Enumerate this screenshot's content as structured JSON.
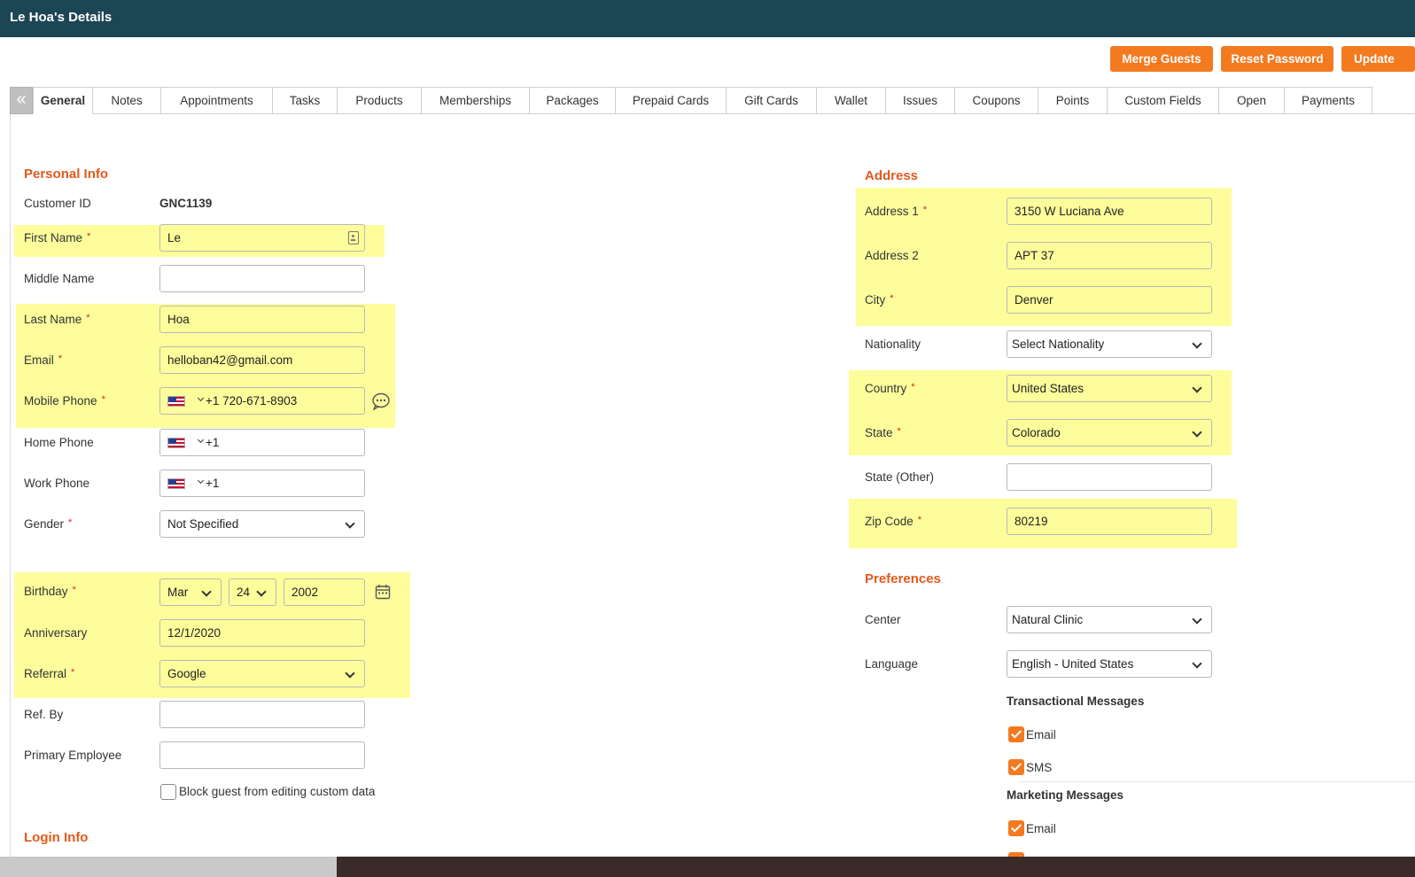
{
  "header": {
    "title": "Le Hoa's Details"
  },
  "actions": {
    "merge": "Merge Guests",
    "reset": "Reset Password",
    "update": "Update"
  },
  "tabs": [
    "General",
    "Notes",
    "Appointments",
    "Tasks",
    "Products",
    "Memberships",
    "Packages",
    "Prepaid Cards",
    "Gift Cards",
    "Wallet",
    "Issues",
    "Coupons",
    "Points",
    "Custom Fields",
    "Open",
    "Payments"
  ],
  "personal": {
    "title": "Personal Info",
    "customer_id_label": "Customer ID",
    "customer_id": "GNC1139",
    "first_name_label": "First Name",
    "first_name": "Le",
    "middle_name_label": "Middle Name",
    "middle_name": "",
    "last_name_label": "Last Name",
    "last_name": "Hoa",
    "email_label": "Email",
    "email": "helloban42@gmail.com",
    "mobile_label": "Mobile Phone",
    "mobile": "+1 720-671-8903",
    "home_label": "Home Phone",
    "home": "+1",
    "work_label": "Work Phone",
    "work": "+1",
    "gender_label": "Gender",
    "gender": "Not Specified",
    "birthday_label": "Birthday",
    "birth_month": "Mar",
    "birth_day": "24",
    "birth_year": "2002",
    "anniversary_label": "Anniversary",
    "anniversary": "12/1/2020",
    "referral_label": "Referral",
    "referral": "Google",
    "refby_label": "Ref. By",
    "refby": "",
    "primary_emp_label": "Primary Employee",
    "primary_emp": "",
    "block_label": "Block guest from editing custom data"
  },
  "login": {
    "title": "Login Info"
  },
  "address": {
    "title": "Address",
    "addr1_label": "Address 1",
    "addr1": "3150 W Luciana Ave",
    "addr2_label": "Address 2",
    "addr2": "APT 37",
    "city_label": "City",
    "city": "Denver",
    "nationality_label": "Nationality",
    "nationality": "Select Nationality",
    "country_label": "Country",
    "country": "United States",
    "state_label": "State",
    "state": "Colorado",
    "state_other_label": "State (Other)",
    "state_other": "",
    "zip_label": "Zip Code",
    "zip": "80219"
  },
  "preferences": {
    "title": "Preferences",
    "center_label": "Center",
    "center": "Natural Clinic",
    "language_label": "Language",
    "language": "English - United States",
    "transactional_title": "Transactional Messages",
    "t_email": "Email",
    "t_sms": "SMS",
    "marketing_title": "Marketing Messages",
    "m_email": "Email"
  },
  "required_mark": "*"
}
